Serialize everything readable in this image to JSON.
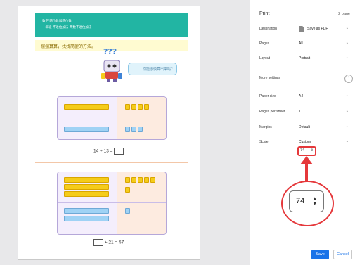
{
  "print": {
    "title": "Print",
    "page_count": "2 page",
    "settings": [
      {
        "label": "Destination",
        "value": "Save as PDF"
      },
      {
        "label": "Pages",
        "value": "All"
      },
      {
        "label": "Layout",
        "value": "Portrait"
      },
      {
        "label": "More settings",
        "value": ""
      },
      {
        "label": "Paper size",
        "value": "A4"
      },
      {
        "label": "Pages per sheet",
        "value": "1"
      },
      {
        "label": "Margins",
        "value": "Default"
      },
      {
        "label": "Scale",
        "value": "Custom"
      }
    ],
    "scale_value": "74",
    "zoom_scale_value": "74",
    "save_label": "Save",
    "cancel_label": "Cancel"
  },
  "preview": {
    "banner_line1": "数学    两位数加两位数",
    "banner_line2": "一年级    不进位加法   两数不进位加法",
    "prompt": "摆摆算算，找找简便的方法。",
    "question_marks": "???",
    "bubble_text": "你能很快算出来吗？",
    "equation1": "14 + 13 =",
    "equation2": "+ 21 = 57"
  },
  "colors": {
    "banner": "#22b5a3",
    "highlight": "#e5383b",
    "primary_button": "#1a73e8"
  },
  "icons": [
    "pdf-icon",
    "chevron-down-icon",
    "chevron-up-icon",
    "stepper-icon",
    "arrow-up-icon"
  ]
}
